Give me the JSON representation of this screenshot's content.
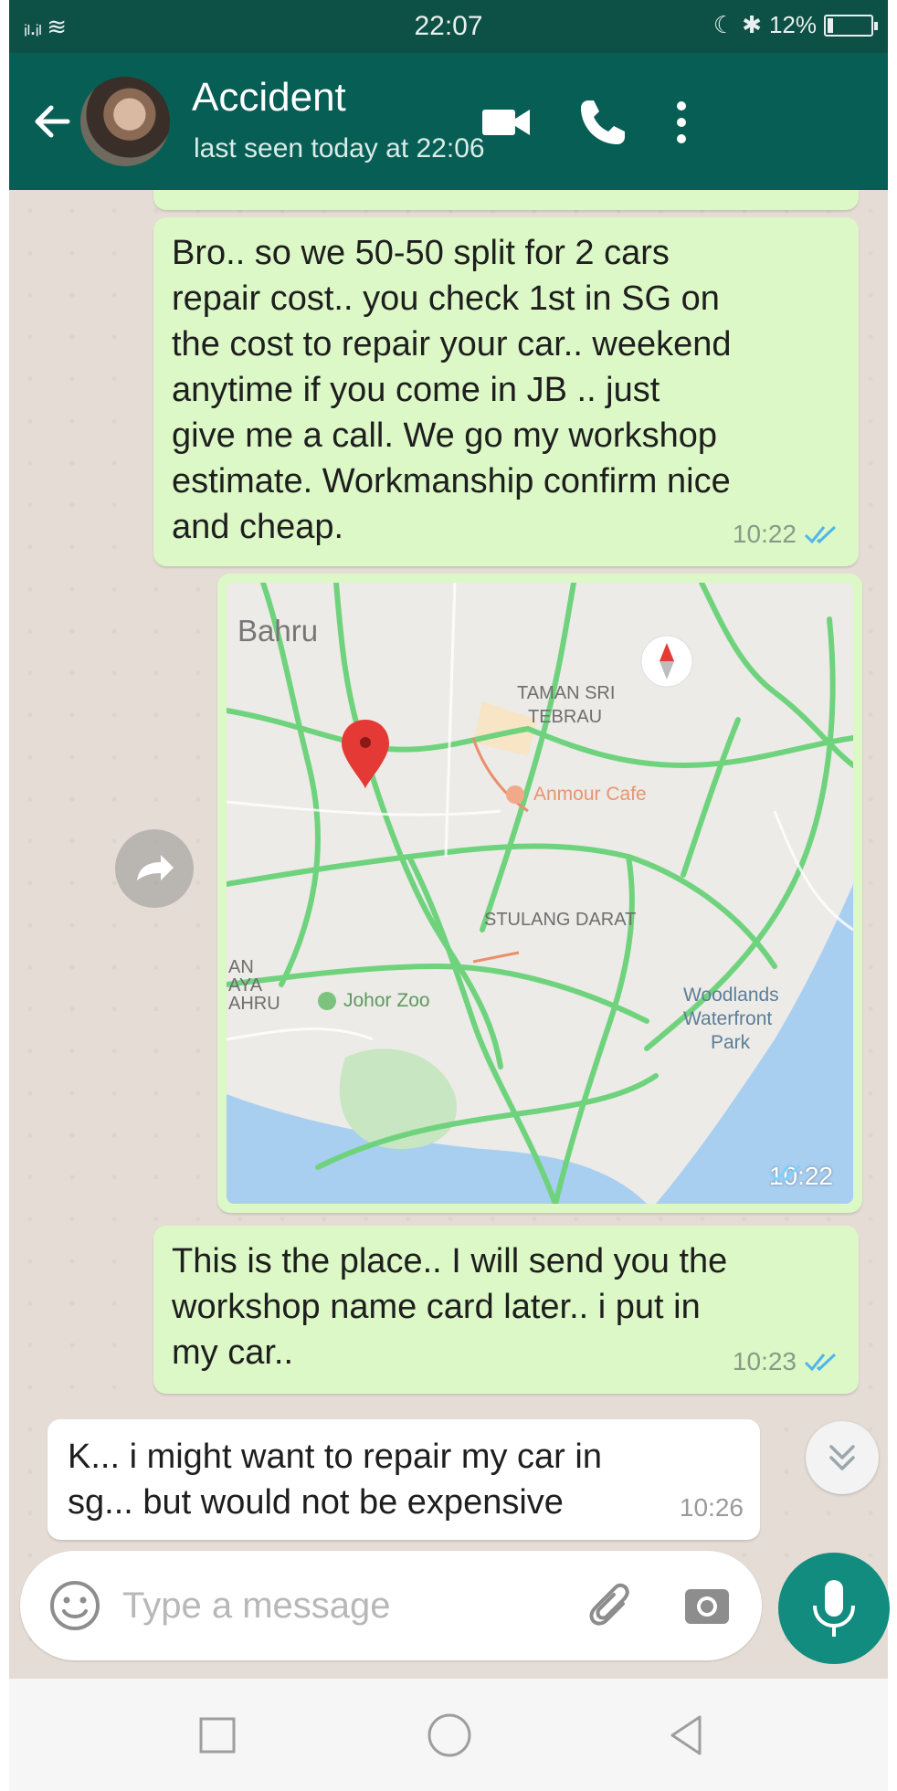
{
  "status_bar": {
    "signal_text": "ᵢₗ.ᵢₗ ≋",
    "time": "22:07",
    "battery_text": "12%",
    "battery_level": 0.12
  },
  "header": {
    "contact_name": "Accident",
    "last_seen": "last seen today at 22:06",
    "icons": [
      "back-arrow-icon",
      "video-call-icon",
      "phone-icon",
      "more-options-icon"
    ]
  },
  "messages": [
    {
      "direction": "out",
      "lines": [
        "Bro.. so we 50-50 split for 2 cars",
        "repair cost.. you check 1st in SG on",
        "the cost to repair your car.. weekend",
        "anytime if you come in JB .. just",
        "give me a call. We go my workshop",
        "estimate. Workmanship confirm nice",
        "and cheap."
      ],
      "time": "10:22"
    },
    {
      "direction": "out",
      "type": "location",
      "map_labels": {
        "bahru": "Bahru",
        "taman": "TAMAN SRI",
        "tebrau": "TEBRAU",
        "cafe": "Anmour Cafe",
        "stulang": "STULANG DARAT",
        "zoo": "Johor Zoo",
        "woodlands1": "Woodlands",
        "woodlands2": "Waterfront",
        "woodlands3": "Park",
        "edge1": "AN",
        "edge2": "AYA",
        "edge3": "AHRU"
      },
      "time": "10:22"
    },
    {
      "direction": "out",
      "lines": [
        "This is the place.. I will send you the",
        "workshop name card later.. i put in",
        "my car.."
      ],
      "time": "10:23"
    },
    {
      "direction": "in",
      "lines": [
        "K... i might want to repair my car in",
        "sg... but would not be expensive"
      ],
      "time": "10:26"
    }
  ],
  "input": {
    "placeholder": "Type a message"
  },
  "colors": {
    "header": "#075e54",
    "status_bar": "#0c5046",
    "outgoing_bubble": "#dcf8c6",
    "incoming_bubble": "#ffffff",
    "chat_background": "#e5ddd5",
    "mic_button": "#128c7e",
    "read_ticks": "#4fb6ec"
  }
}
